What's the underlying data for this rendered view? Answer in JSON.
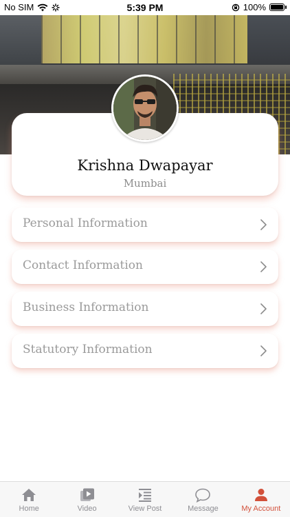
{
  "status_bar": {
    "carrier": "No SIM",
    "time": "5:39 PM",
    "battery": "100%",
    "icons": [
      "wifi-icon",
      "activity-spinner-icon",
      "orientation-lock-icon",
      "battery-icon"
    ]
  },
  "profile": {
    "name": "Krishna Dwapayar",
    "city": "Mumbai",
    "avatar_icon": "profile-photo"
  },
  "info_items": [
    {
      "label": "Personal Information",
      "icon": "chevron-right-icon"
    },
    {
      "label": "Contact Information",
      "icon": "chevron-right-icon"
    },
    {
      "label": "Business Information",
      "icon": "chevron-right-icon"
    },
    {
      "label": "Statutory Information",
      "icon": "chevron-right-icon"
    }
  ],
  "tab_bar": {
    "tabs": [
      {
        "label": "Home",
        "icon": "home-icon",
        "active": false
      },
      {
        "label": "Video",
        "icon": "video-icon",
        "active": false
      },
      {
        "label": "View Post",
        "icon": "view-post-icon",
        "active": false
      },
      {
        "label": "Message",
        "icon": "message-icon",
        "active": false
      },
      {
        "label": "My Account",
        "icon": "account-icon",
        "active": true
      }
    ]
  },
  "colors": {
    "accent": "#d2503a",
    "inactive_tab": "#8e8e93",
    "card_shadow": "#e88c78",
    "muted_text": "#9a9a9a"
  }
}
